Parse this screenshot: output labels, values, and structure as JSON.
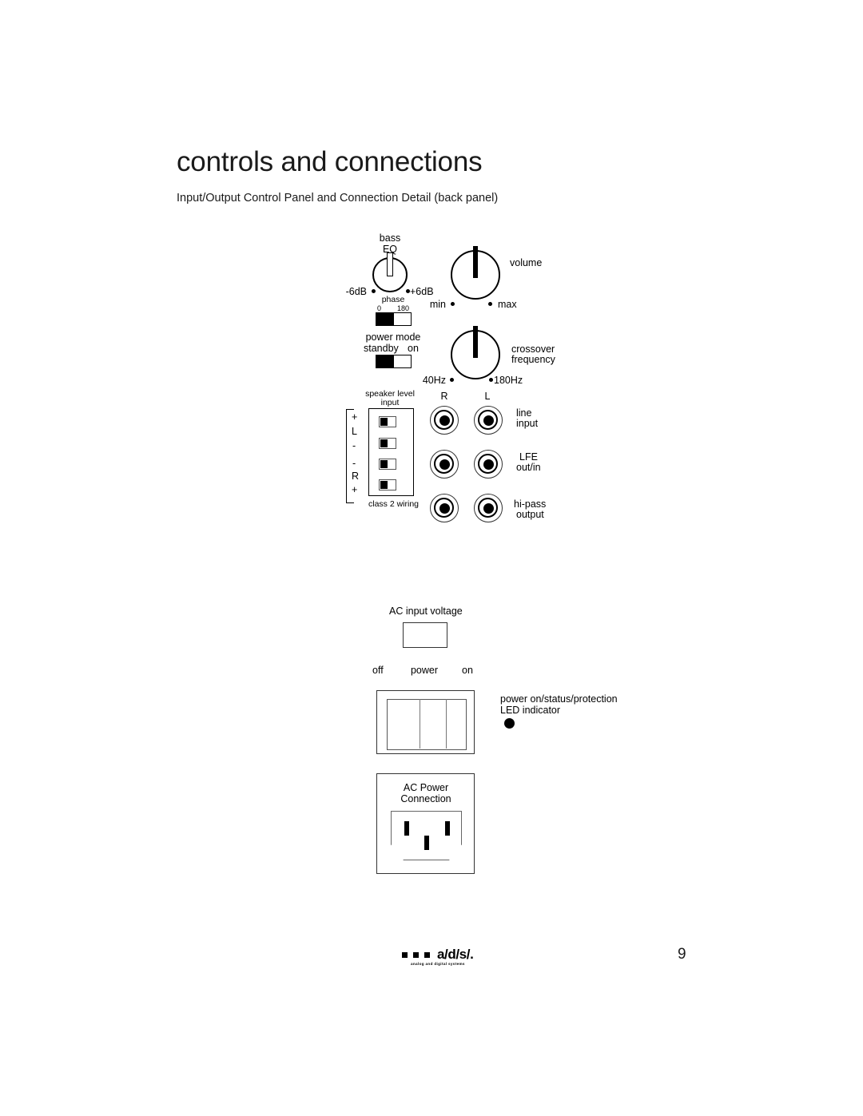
{
  "header": {
    "title": "controls and connections",
    "subtitle": "Input/Output Control Panel and Connection Detail (back panel)"
  },
  "control_panel": {
    "bass_eq": {
      "label_line1": "bass",
      "label_line2": "EQ",
      "min_label": "-6dB",
      "max_label": "+6dB"
    },
    "phase": {
      "label": "phase",
      "position_left": "0",
      "position_right": "180"
    },
    "volume": {
      "label": "volume",
      "min_label": "min",
      "max_label": "max"
    },
    "power_mode": {
      "label": "power mode",
      "position_left": "standby",
      "position_right": "on"
    },
    "crossover": {
      "label_line1": "crossover",
      "label_line2": "frequency",
      "min_label": "40Hz",
      "max_label": "180Hz"
    },
    "speaker_level_input": {
      "label_line1": "speaker level",
      "label_line2": "input",
      "terminal_labels": [
        "+",
        "L",
        "-",
        "-",
        "R",
        "+"
      ],
      "footnote": "class 2 wiring"
    },
    "jacks": {
      "column_headers": [
        "R",
        "L"
      ],
      "rows": [
        {
          "label_line1": "line",
          "label_line2": "input"
        },
        {
          "label_line1": "LFE",
          "label_line2": "out/in"
        },
        {
          "label_line1": "hi-pass",
          "label_line2": "output"
        }
      ]
    }
  },
  "power_section": {
    "ac_input_voltage_label": "AC input voltage",
    "power_switch": {
      "label": "power",
      "off_label": "off",
      "on_label": "on"
    },
    "led_indicator": {
      "label_line1": "power on/status/protection",
      "label_line2": "LED indicator"
    },
    "ac_power_connection": {
      "label_line1": "AC Power",
      "label_line2": "Connection"
    }
  },
  "footer": {
    "brand": "a/d/s/.",
    "tagline": "analog and digital systems",
    "page_number": "9"
  }
}
